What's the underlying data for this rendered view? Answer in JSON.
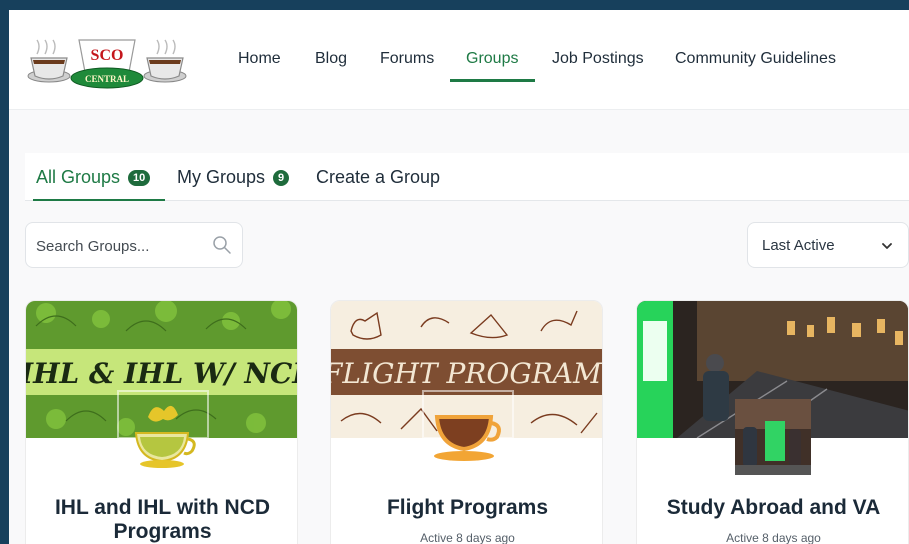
{
  "logo": {
    "top_text": "SCO",
    "bottom_text": "CENTRAL"
  },
  "nav": {
    "items": [
      {
        "label": "Home"
      },
      {
        "label": "Blog"
      },
      {
        "label": "Forums"
      },
      {
        "label": "Groups",
        "active": true
      },
      {
        "label": "Job Postings"
      },
      {
        "label": "Community Guidelines"
      }
    ]
  },
  "tabs": [
    {
      "label": "All Groups",
      "count": "10",
      "active": true
    },
    {
      "label": "My Groups",
      "count": "9"
    },
    {
      "label": "Create a Group"
    }
  ],
  "search": {
    "placeholder": "Search Groups..."
  },
  "sort": {
    "selected": "Last Active"
  },
  "groups": [
    {
      "title": "IHL and IHL with NCD Programs",
      "banner_text": "IHL & IHL W/ NCD",
      "meta": ""
    },
    {
      "title": "Flight Programs",
      "banner_text": "FLIGHT PROGRAMS",
      "meta": "Active 8 days ago"
    },
    {
      "title": "Study Abroad and VA",
      "banner_text": "",
      "meta": "Active 8 days ago"
    }
  ],
  "colors": {
    "accent": "#1e7a45",
    "badge": "#1e6b3c",
    "frame": "#17405c"
  }
}
